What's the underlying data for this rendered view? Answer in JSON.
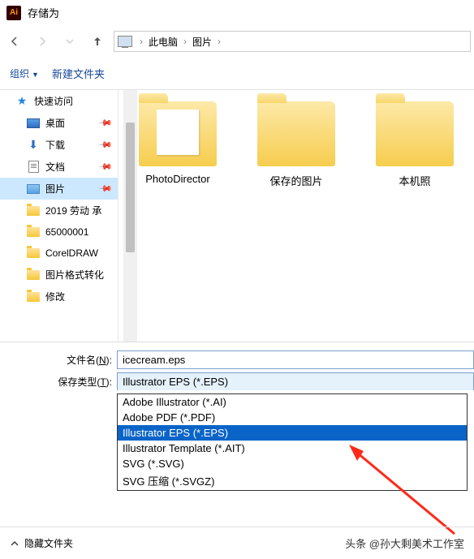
{
  "titlebar": {
    "title": "存储为",
    "app_icon_text": "Ai"
  },
  "nav": {
    "breadcrumb": [
      "此电脑",
      "图片"
    ]
  },
  "toolbar": {
    "organize": "组织",
    "new_folder": "新建文件夹"
  },
  "sidebar": {
    "items": [
      {
        "label": "快速访问",
        "icon": "star",
        "pinned": false,
        "indent": 0
      },
      {
        "label": "桌面",
        "icon": "desk",
        "pinned": true,
        "indent": 1
      },
      {
        "label": "下载",
        "icon": "dl",
        "pinned": true,
        "indent": 1
      },
      {
        "label": "文档",
        "icon": "doc",
        "pinned": true,
        "indent": 1
      },
      {
        "label": "图片",
        "icon": "pic",
        "pinned": true,
        "indent": 1,
        "selected": true
      },
      {
        "label": "2019 劳动 承",
        "icon": "fold",
        "pinned": false,
        "indent": 1
      },
      {
        "label": "65000001",
        "icon": "fold",
        "pinned": false,
        "indent": 1
      },
      {
        "label": "CorelDRAW",
        "icon": "fold",
        "pinned": false,
        "indent": 1
      },
      {
        "label": "图片格式转化",
        "icon": "fold",
        "pinned": false,
        "indent": 1
      },
      {
        "label": "修改",
        "icon": "fold",
        "pinned": false,
        "indent": 1
      }
    ]
  },
  "folders": [
    {
      "label": "PhotoDirector",
      "variant": "photo"
    },
    {
      "label": "保存的图片",
      "variant": "plain"
    },
    {
      "label": "本机照",
      "variant": "plain"
    }
  ],
  "form": {
    "filename_label_pre": "文件名(",
    "filename_label_key": "N",
    "filename_label_post": "):",
    "filename_value": "icecream.eps",
    "type_label_pre": "保存类型(",
    "type_label_key": "T",
    "type_label_post": "):",
    "type_selected": "Illustrator EPS (*.EPS)",
    "type_options": [
      "Adobe Illustrator (*.AI)",
      "Adobe PDF (*.PDF)",
      "Illustrator EPS (*.EPS)",
      "Illustrator Template (*.AIT)",
      "SVG (*.SVG)",
      "SVG 压缩 (*.SVGZ)"
    ],
    "highlighted_index": 2
  },
  "footer": {
    "hide_folders": "隐藏文件夹",
    "watermark": "头条 @孙大剩美术工作室"
  }
}
